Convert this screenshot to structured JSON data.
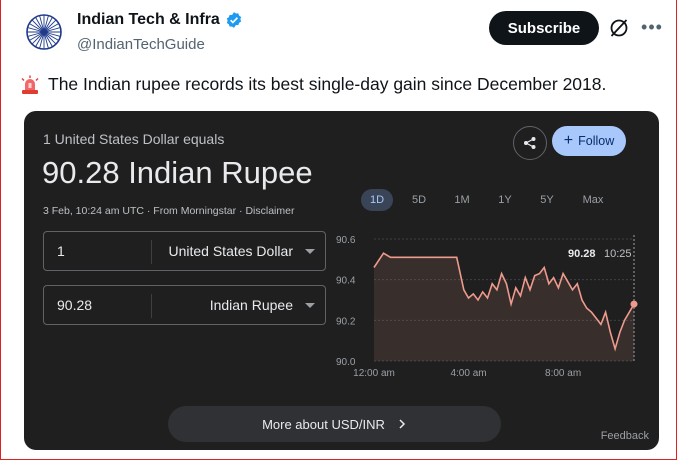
{
  "author": {
    "name": "Indian Tech & Infra",
    "handle": "@IndianTechGuide",
    "verified_color": "#1d9bf0"
  },
  "actions": {
    "subscribe_label": "Subscribe",
    "grok_icon": "slashed-circle-icon",
    "more_icon": "more-horizontal-icon"
  },
  "tweet": {
    "emoji": "rotating-light-icon",
    "text": "The Indian rupee records its best single-day gain since December 2018."
  },
  "card": {
    "equals_text": "1 United States Dollar equals",
    "result": "90.28 Indian Rupee",
    "meta": "3 Feb, 10:24 am UTC · From Morningstar · Disclaimer",
    "follow_label": "Follow",
    "from": {
      "amount": "1",
      "currency": "United States Dollar"
    },
    "to": {
      "amount": "90.28",
      "currency": "Indian Rupee"
    },
    "ranges": [
      "1D",
      "5D",
      "1M",
      "1Y",
      "5Y",
      "Max"
    ],
    "active_range": "1D",
    "more_label": "More about USD/INR",
    "feedback": "Feedback",
    "tooltip_value": "90.28",
    "tooltip_time": "10:25"
  },
  "chart_data": {
    "type": "line",
    "title": "",
    "xlabel": "",
    "ylabel": "",
    "ylim": [
      90.0,
      90.6
    ],
    "yticks": [
      90.0,
      90.2,
      90.4,
      90.6
    ],
    "xticks": [
      {
        "x": 0,
        "label": "12:00 am"
      },
      {
        "x": 4,
        "label": "4:00 am"
      },
      {
        "x": 8,
        "label": "8:00 am"
      }
    ],
    "x_unit": "hours since 12:00 am",
    "xlim": [
      0,
      11
    ],
    "series": [
      {
        "color": "#ee9a8c",
        "x": [
          0,
          0.4,
          0.7,
          1.0,
          1.5,
          2.0,
          2.5,
          3.0,
          3.5,
          3.8,
          4.0,
          4.2,
          4.4,
          4.6,
          4.8,
          5.0,
          5.2,
          5.4,
          5.6,
          5.8,
          6.0,
          6.2,
          6.4,
          6.6,
          6.8,
          7.0,
          7.2,
          7.4,
          7.6,
          7.8,
          8.0,
          8.2,
          8.4,
          8.6,
          8.8,
          9.0,
          9.2,
          9.4,
          9.6,
          9.8,
          10.0,
          10.2,
          10.4,
          10.6,
          10.8,
          11.0
        ],
        "y": [
          90.46,
          90.53,
          90.51,
          90.51,
          90.51,
          90.51,
          90.51,
          90.51,
          90.51,
          90.35,
          90.31,
          90.33,
          90.3,
          90.34,
          90.31,
          90.38,
          90.35,
          90.43,
          90.38,
          90.28,
          90.36,
          90.32,
          90.41,
          90.35,
          90.42,
          90.43,
          90.46,
          90.38,
          90.41,
          90.36,
          90.43,
          90.39,
          90.35,
          90.38,
          90.3,
          90.26,
          90.24,
          90.21,
          90.18,
          90.24,
          90.14,
          90.06,
          90.14,
          90.2,
          90.24,
          90.28
        ]
      }
    ],
    "current": {
      "x": 11.0,
      "y": 90.28,
      "label": "90.28",
      "time": "10:25"
    }
  }
}
